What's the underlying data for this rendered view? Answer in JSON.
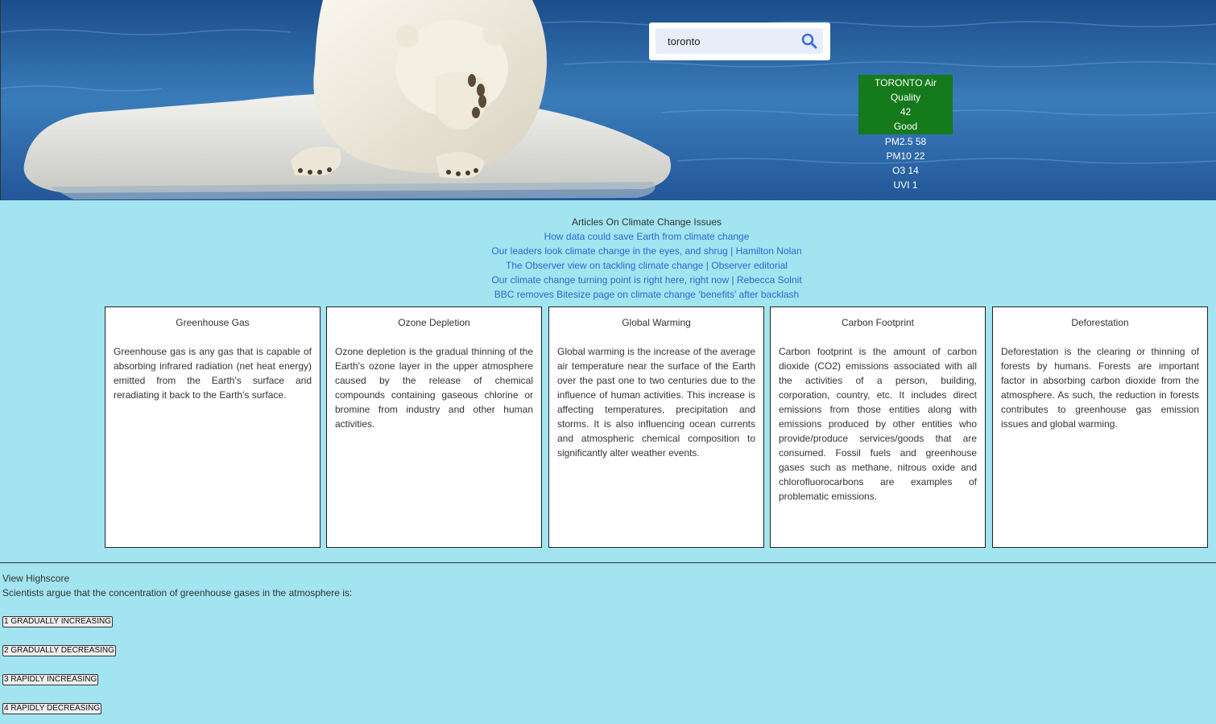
{
  "search": {
    "value": "toronto"
  },
  "air_quality": {
    "title": "TORONTO Air Quality",
    "aqi": "42",
    "status": "Good",
    "pm25": "PM2.5 58",
    "pm10": "PM10 22",
    "o3": "O3 14",
    "uvi": "UVI 1",
    "status_color": "#157a1c"
  },
  "articles": {
    "heading": "Articles On Climate Change Issues",
    "links": [
      "How data could save Earth from climate change",
      "Our leaders look climate change in the eyes, and shrug | Hamilton Nolan",
      "The Observer view on tackling climate change | Observer editorial",
      "Our climate change turning point is right here, right now | Rebecca Solnit",
      "BBC removes Bitesize page on climate change ‘benefits’ after backlash"
    ],
    "link_color": "#2a6ad1"
  },
  "cards": [
    {
      "title": "Greenhouse Gas",
      "text": "Greenhouse gas is any gas that is capable of absorbing infrared radiation (net heat energy) emitted from the Earth's surface and reradiating it back to the Earth's surface."
    },
    {
      "title": "Ozone Depletion",
      "text": "Ozone depletion is the gradual thinning of the Earth's ozone layer in the upper atmosphere caused by the release of chemical compounds containing gaseous chlorine or bromine from industry and other human activities."
    },
    {
      "title": "Global Warming",
      "text": "Global warming is the increase of the average air temperature near the surface of the Earth over the past one to two centuries due to the influence of human activities. This increase is affecting temperatures, precipitation and storms. It is also influencing ocean currents and atmospheric chemical composition to significantly alter weather events."
    },
    {
      "title": "Carbon Footprint",
      "text": "Carbon footprint is the amount of carbon dioxide (CO2) emissions associated with all the activities of a person, building, corporation, country, etc. It includes direct emissions from those entities along with emissions produced by other entities who provide/produce services/goods that are consumed. Fossil fuels and greenhouse gases such as methane, nitrous oxide and chlorofluorocarbons are examples of problematic emissions."
    },
    {
      "title": "Deforestation",
      "text": "Deforestation is the clearing or thinning of forests by humans. Forests are important factor in absorbing carbon dioxide from the atmosphere. As such, the reduction in forests contributes to greenhouse gas emission issues and global warming."
    }
  ],
  "quiz": {
    "highscore_link": "View Highscore",
    "question": "Scientists argue that the concentration of greenhouse gases in the atmosphere is:",
    "answers": [
      "1 GRADUALLY INCREASING",
      "2 GRADUALLY DECREASING",
      "3 RAPIDLY INCREASING",
      "4 RAPIDLY DECREASING"
    ]
  },
  "icons": {
    "search": "search-icon"
  },
  "colors": {
    "page_background": "#a2e4f0",
    "hero_water": "#2a68a8"
  }
}
